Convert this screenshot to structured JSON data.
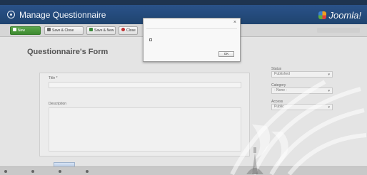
{
  "header": {
    "title": "Manage Questionnaire",
    "brand": "Joomla!"
  },
  "toolbar": {
    "new_label": "New",
    "save_close_label": "Save & Close",
    "save_new_label": "Save & New",
    "close_label": "Close"
  },
  "form": {
    "heading": "Questionnaire's Form",
    "title_label": "Title *",
    "description_label": "Description"
  },
  "sidebar": {
    "status_label": "Status",
    "status_value": "Published",
    "category_label": "Category",
    "category_value": "- None -",
    "access_label": "Access",
    "access_value": "Public"
  },
  "dialog": {
    "ok_label": "OK"
  },
  "colors": {
    "header_bg": "#2a5289",
    "new_button": "#4e9a3e",
    "page_bg": "#e4e4e4"
  },
  "icons": {
    "header_logo": "joomla-logo-icon",
    "new": "check-icon",
    "save_close": "save-icon",
    "save_new": "plus-icon",
    "close": "close-icon"
  }
}
